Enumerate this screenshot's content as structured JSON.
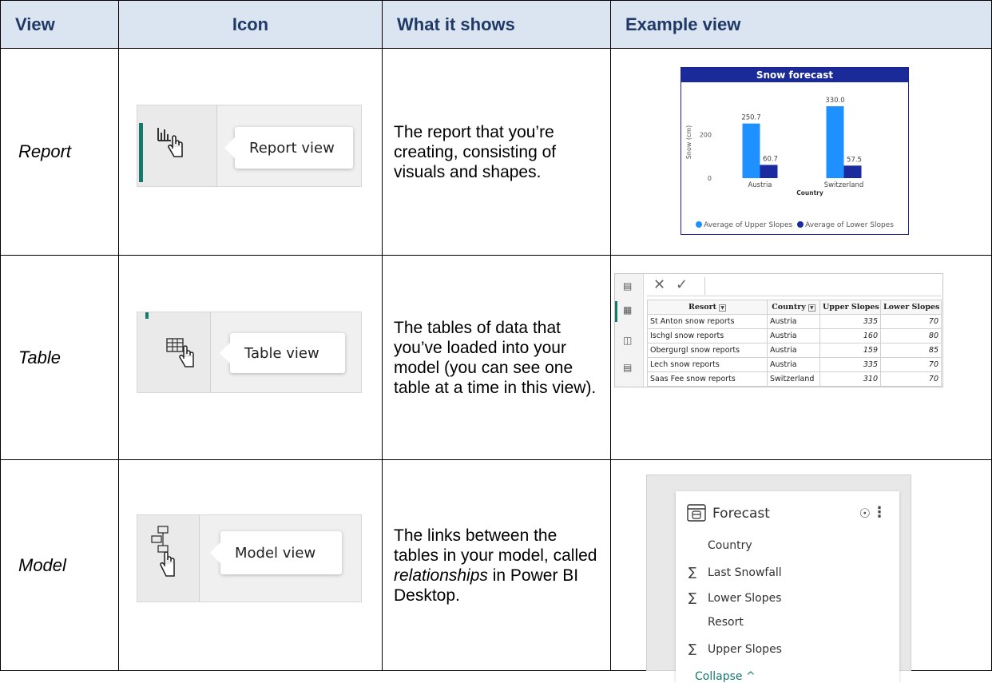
{
  "headers": {
    "view": "View",
    "icon": "Icon",
    "shows": "What it shows",
    "example": "Example view"
  },
  "rows": [
    {
      "view": "Report",
      "tooltip": "Report view",
      "description": "The report that you’re creating, consisting of visuals and shapes."
    },
    {
      "view": "Table",
      "tooltip": "Table view",
      "description": "The tables of data that you’ve loaded into your model (you can see one table at a time in this view)."
    },
    {
      "view": "Model",
      "tooltip": "Model view",
      "description_pre": "The links between the tables in your model, called ",
      "description_em": "relationships",
      "description_post": " in Power BI Desktop."
    }
  ],
  "chart_data": {
    "type": "bar",
    "title": "Snow forecast",
    "xlabel": "Country",
    "ylabel": "Snow (cm)",
    "categories": [
      "Austria",
      "Switzerland"
    ],
    "series": [
      {
        "name": "Average of Upper Slopes",
        "values": [
          250.7,
          330.0
        ],
        "color": "#1e90ff"
      },
      {
        "name": "Average of Lower Slopes",
        "values": [
          60.7,
          57.5
        ],
        "color": "#1c2aa0"
      }
    ],
    "ylim": [
      0,
      330
    ],
    "yticks": [
      "0",
      "200"
    ],
    "data_labels": [
      "250.7",
      "60.7",
      "330.0",
      "57.5"
    ],
    "legend_position": "bottom"
  },
  "data_table": {
    "columns": [
      "Resort",
      "Country",
      "Upper Slopes",
      "Lower Slopes"
    ],
    "rows": [
      [
        "St Anton snow reports",
        "Austria",
        "335",
        "70"
      ],
      [
        "Ischgl snow reports",
        "Austria",
        "160",
        "80"
      ],
      [
        "Obergurgl snow reports",
        "Austria",
        "159",
        "85"
      ],
      [
        "Lech snow reports",
        "Austria",
        "335",
        "70"
      ],
      [
        "Saas Fee snow reports",
        "Switzerland",
        "310",
        "70"
      ]
    ],
    "cancel_symbol": "✕",
    "confirm_symbol": "✓"
  },
  "model_card": {
    "table_name": "Forecast",
    "fields": [
      {
        "name": "Country",
        "sigma": ""
      },
      {
        "name": "Last Snowfall",
        "sigma": "∑"
      },
      {
        "name": "Lower Slopes",
        "sigma": "∑"
      },
      {
        "name": "Resort",
        "sigma": ""
      },
      {
        "name": "Upper Slopes",
        "sigma": "∑"
      }
    ],
    "collapse_label": "Collapse ^"
  },
  "colors": {
    "header_bg": "#dbe5f1",
    "header_text": "#1f3864",
    "accent": "#157a6e"
  }
}
